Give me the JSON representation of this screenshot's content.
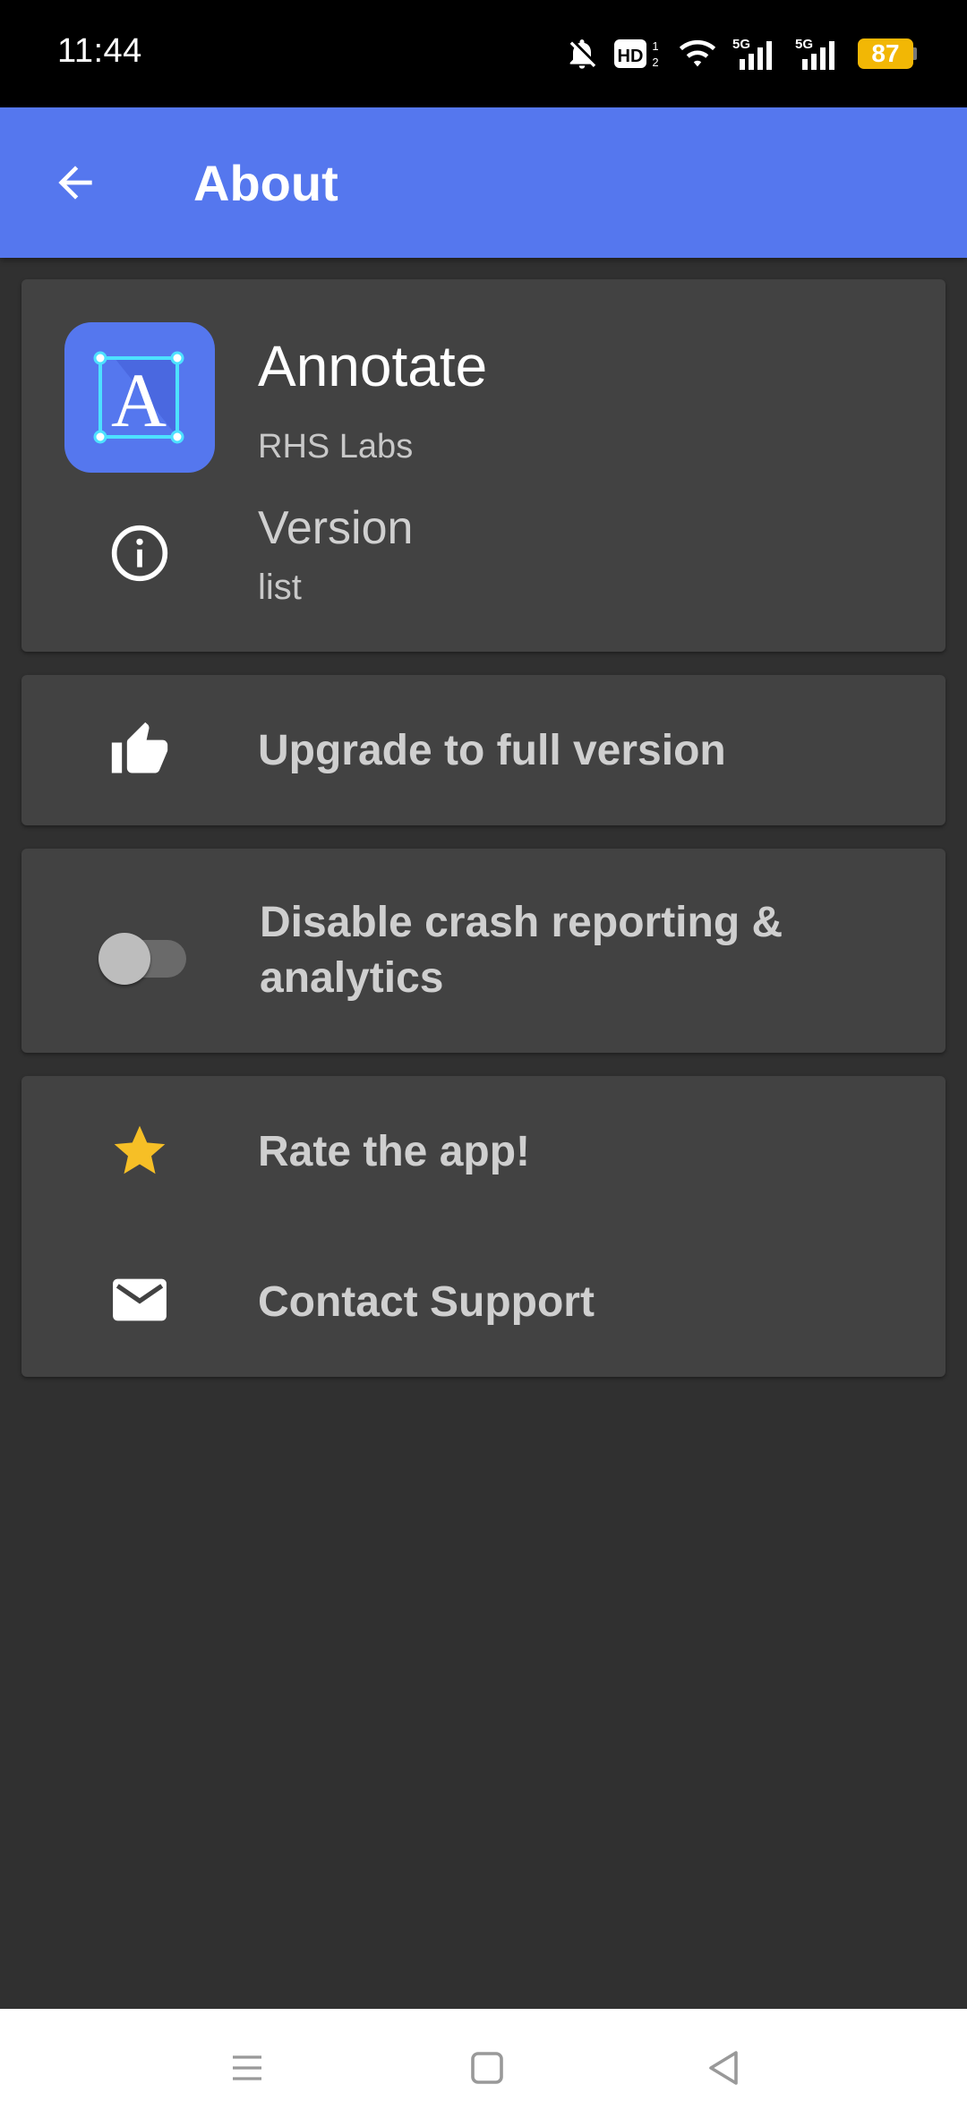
{
  "status_bar": {
    "time": "11:44",
    "network_1": "5G",
    "network_2": "5G",
    "battery": "87",
    "icons": [
      "bell-off-icon",
      "hd-voice-icon",
      "wifi-icon",
      "signal-5g-icon",
      "signal-5g-icon",
      "battery-icon"
    ]
  },
  "app_bar": {
    "title": "About",
    "back_icon": "arrow-back-icon"
  },
  "app_info": {
    "name": "Annotate",
    "developer": "RHS Labs",
    "version_label": "Version",
    "version_value": "list",
    "icon_letter": "A"
  },
  "actions": {
    "upgrade_label": "Upgrade to full version",
    "crash_line1": "Disable crash reporting &",
    "crash_line2": "analytics",
    "crash_toggle_on": false,
    "rate_label": "Rate the app!",
    "contact_label": "Contact Support"
  },
  "colors": {
    "primary": "#5577ee",
    "background": "#303030",
    "card": "#424242",
    "star": "#f6bf26",
    "battery": "#f2b705"
  }
}
